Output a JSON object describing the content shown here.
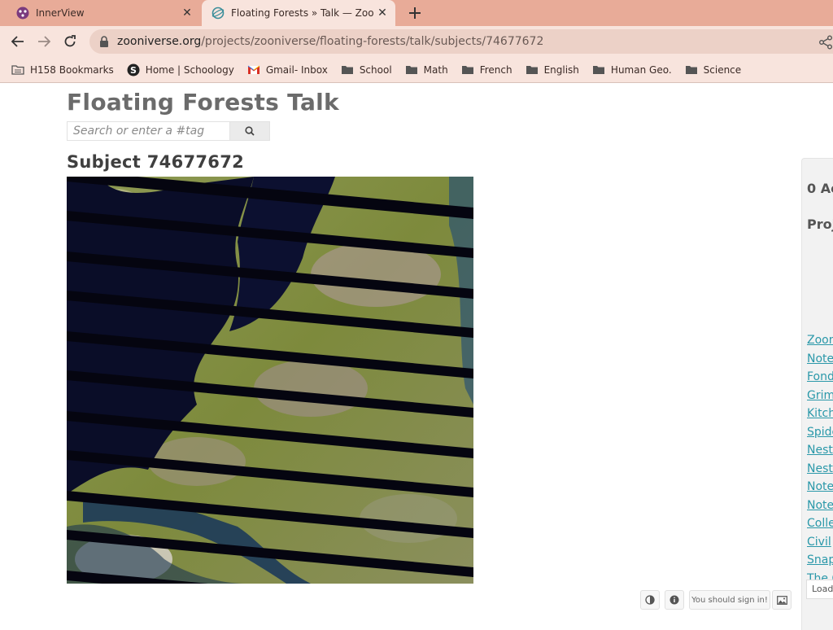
{
  "tabs": [
    {
      "title": "InnerView",
      "favicon": "innerview-icon"
    },
    {
      "title": "Floating Forests » Talk — Zooniverse",
      "favicon": "zooniverse-icon"
    }
  ],
  "toolbar": {
    "url_host": "zooniverse.org",
    "url_path": "/projects/zooniverse/floating-forests/talk/subjects/74677672"
  },
  "bookmarks": [
    {
      "label": "H158 Bookmarks",
      "icon": "folder-icon"
    },
    {
      "label": "Home | Schoology",
      "icon": "schoology-icon"
    },
    {
      "label": "Gmail- Inbox",
      "icon": "gmail-icon"
    },
    {
      "label": "School",
      "icon": "folder-icon"
    },
    {
      "label": "Math",
      "icon": "folder-icon"
    },
    {
      "label": "French",
      "icon": "folder-icon"
    },
    {
      "label": "English",
      "icon": "folder-icon"
    },
    {
      "label": "Human Geo.",
      "icon": "folder-icon"
    },
    {
      "label": "Science",
      "icon": "folder-icon"
    }
  ],
  "page": {
    "title": "Floating Forests Talk",
    "search_placeholder": "Search or enter a #tag",
    "subject_title": "Subject 74677672"
  },
  "sidebar": {
    "active_heading": "0 Ac",
    "projects_heading": "Proj",
    "links": [
      "Zoon",
      "Note",
      "Fond",
      "Grim",
      "Kitch",
      "Spide",
      "Nest",
      "Nest",
      "Note",
      "Note",
      "Colle",
      "Civil",
      "Snap",
      "The C"
    ],
    "load_more": "Load"
  },
  "controls": {
    "sign_in_label": "You should sign in!"
  },
  "colors": {
    "tab_strip": "#e8ab98",
    "toolbar": "#f8e4dd",
    "link": "#2a98a9"
  }
}
